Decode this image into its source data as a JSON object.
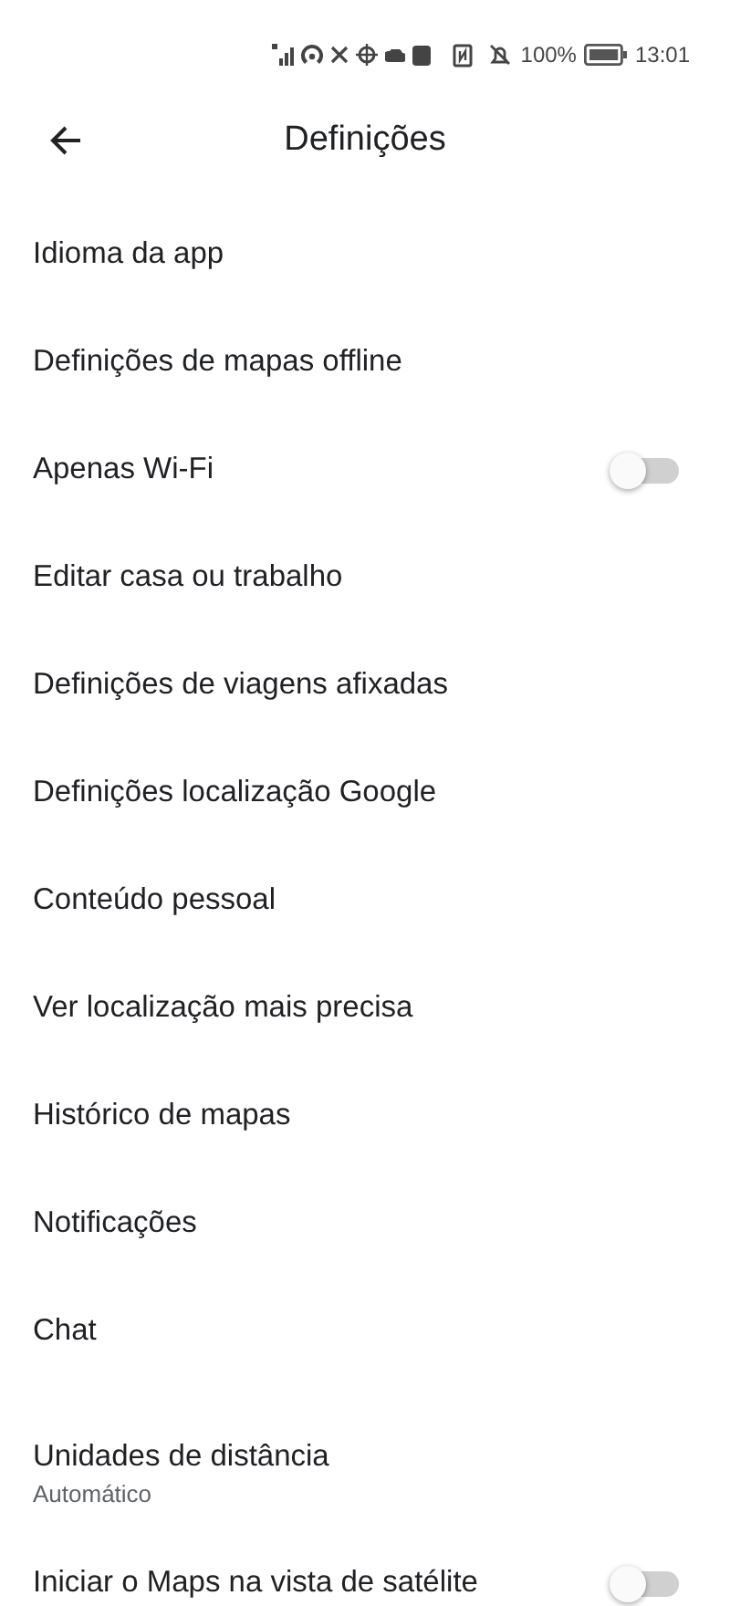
{
  "status_bar": {
    "battery": "100%",
    "time": "13:01"
  },
  "header": {
    "title": "Definições"
  },
  "items": [
    {
      "kind": "link",
      "label": "Idioma da app"
    },
    {
      "kind": "link",
      "label": "Definições de mapas offline"
    },
    {
      "kind": "toggle",
      "label": "Apenas Wi-Fi",
      "on": false
    },
    {
      "kind": "link",
      "label": "Editar casa ou trabalho"
    },
    {
      "kind": "link",
      "label": "Definições de viagens afixadas"
    },
    {
      "kind": "link",
      "label": "Definições localização Google"
    },
    {
      "kind": "link",
      "label": "Conteúdo pessoal"
    },
    {
      "kind": "link",
      "label": "Ver localização mais precisa"
    },
    {
      "kind": "link",
      "label": "Histórico de mapas"
    },
    {
      "kind": "link",
      "label": "Notificações"
    },
    {
      "kind": "link",
      "label": "Chat"
    },
    {
      "kind": "link",
      "label": "Unidades de distância",
      "subtitle": "Automático"
    },
    {
      "kind": "toggle",
      "label": "Iniciar o Maps na vista de satélite",
      "on": false
    }
  ]
}
